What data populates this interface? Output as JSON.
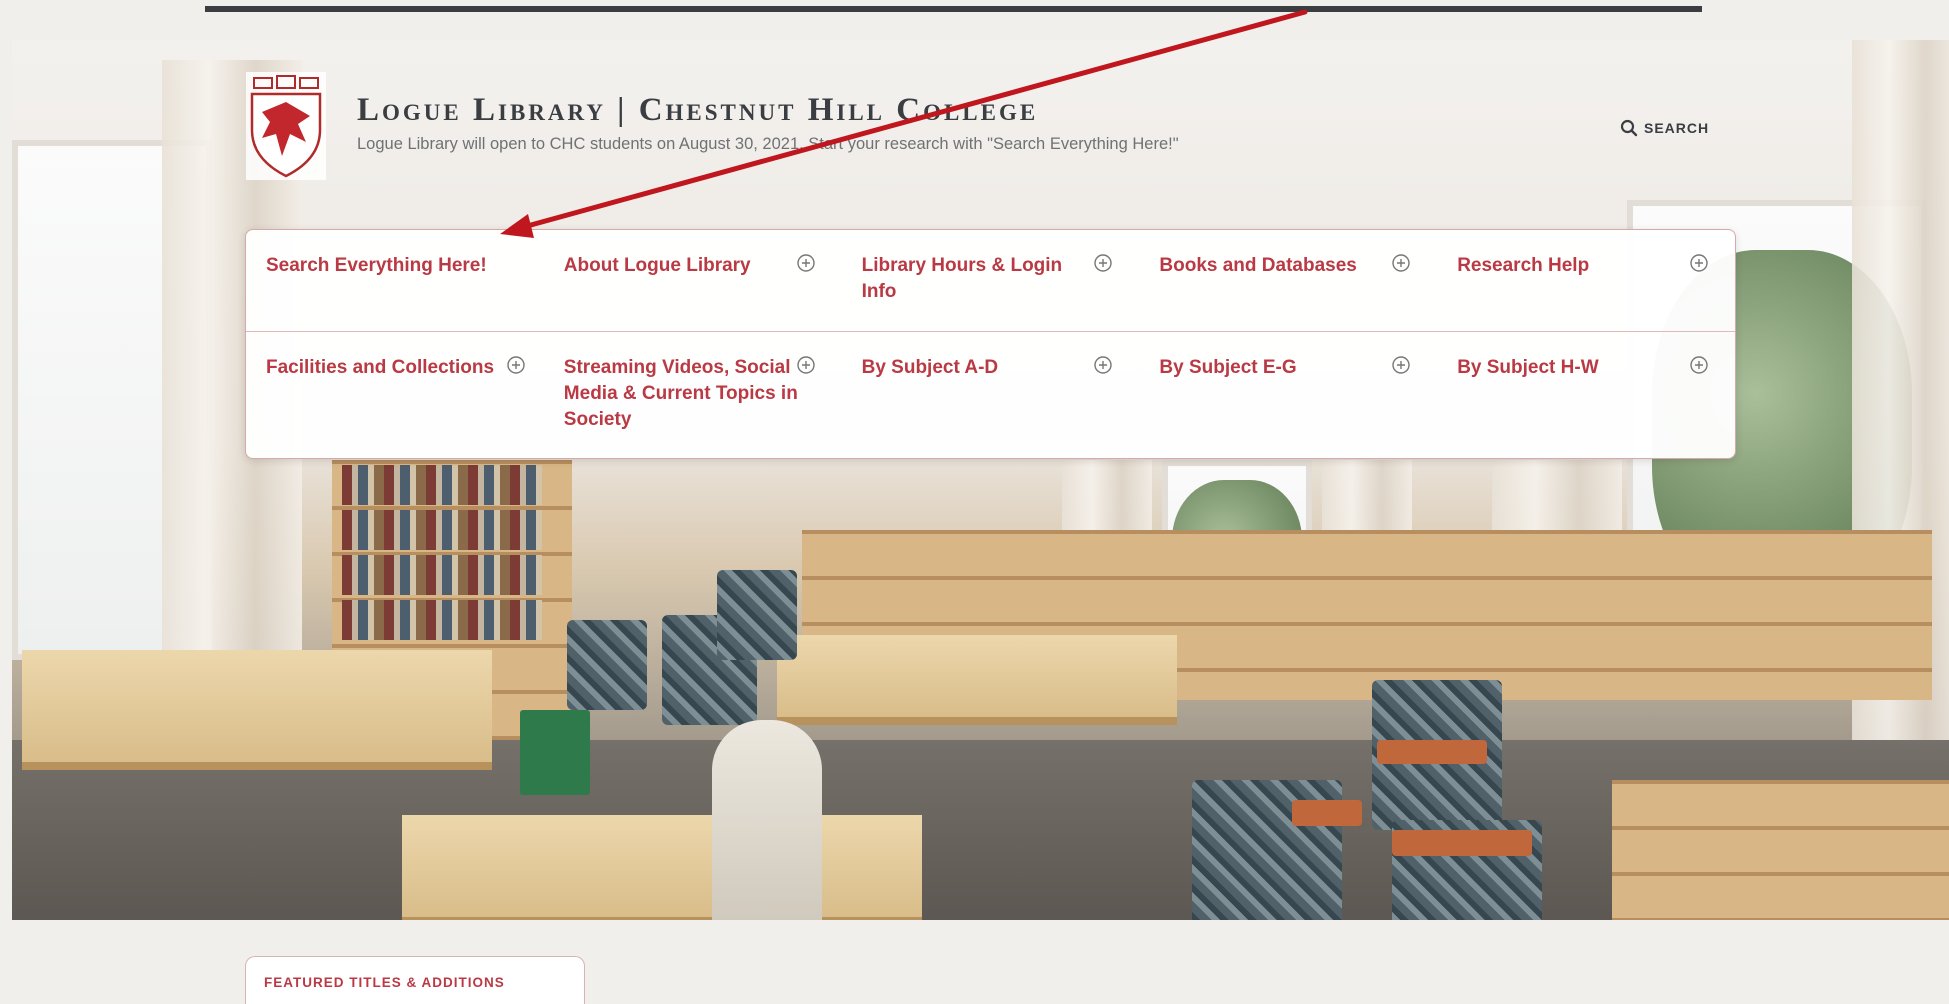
{
  "header": {
    "site_title": "Logue Library | Chestnut Hill College",
    "tagline": "Logue Library will open to CHC students on August 30, 2021. Start your research with \"Search Everything Here!\"",
    "search_label": "SEARCH",
    "search_icon": "search-icon",
    "logo_icon": "college-crest-icon"
  },
  "nav": {
    "row1": [
      {
        "label": "Search Everything Here!",
        "expandable": false
      },
      {
        "label": "About Logue Library",
        "expandable": true
      },
      {
        "label": "Library Hours & Login Info",
        "expandable": true
      },
      {
        "label": "Books and Databases",
        "expandable": true
      },
      {
        "label": "Research Help",
        "expandable": true
      }
    ],
    "row2": [
      {
        "label": "Facilities and Collections",
        "expandable": true
      },
      {
        "label": "Streaming Videos, Social Media & Current Topics in Society",
        "expandable": true
      },
      {
        "label": "By Subject A-D",
        "expandable": true
      },
      {
        "label": "By Subject E-G",
        "expandable": true
      },
      {
        "label": "By Subject H-W",
        "expandable": true
      }
    ],
    "expand_icon": "plus-circle-icon"
  },
  "featured": {
    "tab_label": "FEATURED TITLES & ADDITIONS"
  },
  "colors": {
    "accent": "#b93a44",
    "title_text": "#3a3d41",
    "annotation_arrow": "#c0171f"
  }
}
